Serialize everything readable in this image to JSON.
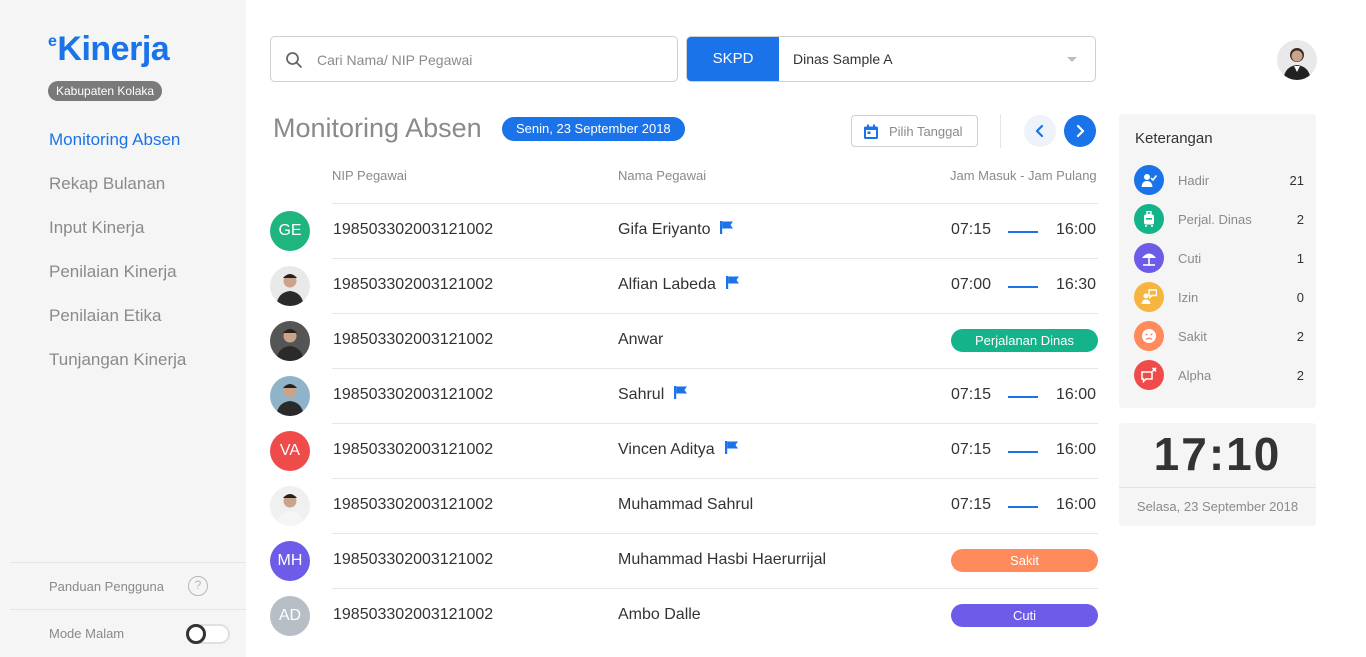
{
  "brand": {
    "logo_text": "Kinerja",
    "logo_prefix": "e",
    "region": "Kabupaten Kolaka"
  },
  "sidebar": {
    "items": [
      {
        "label": "Monitoring Absen"
      },
      {
        "label": "Rekap Bulanan"
      },
      {
        "label": "Input Kinerja"
      },
      {
        "label": "Penilaian Kinerja"
      },
      {
        "label": "Penilaian Etika"
      },
      {
        "label": "Tunjangan Kinerja"
      }
    ],
    "active_index": 0,
    "help_label": "Panduan Pengguna",
    "night_mode_label": "Mode Malam",
    "night_mode_on": false
  },
  "search": {
    "placeholder": "Cari Nama/ NIP Pegawai",
    "value": ""
  },
  "skpd": {
    "tag": "SKPD",
    "selected": "Dinas Sample A"
  },
  "header": {
    "title": "Monitoring Absen",
    "date": "Senin, 23 September 2018",
    "pick_date_label": "Pilih Tanggal"
  },
  "table": {
    "columns": {
      "nip": "NIP Pegawai",
      "name": "Nama Pegawai",
      "hours": "Jam Masuk - Jam Pulang"
    },
    "rows": [
      {
        "initials": "GE",
        "avatar_color": "#1fb57f",
        "nip": "198503302003121002",
        "name": "Gifa Eriyanto",
        "flag": true,
        "in": "07:15",
        "out": "16:00",
        "status": ""
      },
      {
        "initials": "",
        "avatar_color": "#3a3a3a",
        "nip": "198503302003121002",
        "name": "Alfian Labeda",
        "flag": true,
        "in": "07:00",
        "out": "16:30",
        "status": ""
      },
      {
        "initials": "",
        "avatar_color": "#4a4a4a",
        "nip": "198503302003121002",
        "name": "Anwar",
        "flag": false,
        "in": "",
        "out": "",
        "status": "Perjalanan Dinas",
        "status_color": "#14b389"
      },
      {
        "initials": "",
        "avatar_color": "#6b8fa8",
        "nip": "198503302003121002",
        "name": "Sahrul",
        "flag": true,
        "in": "07:15",
        "out": "16:00",
        "status": ""
      },
      {
        "initials": "VA",
        "avatar_color": "#ef4b4b",
        "nip": "198503302003121002",
        "name": "Vincen Aditya",
        "flag": true,
        "in": "07:15",
        "out": "16:00",
        "status": ""
      },
      {
        "initials": "",
        "avatar_color": "#9a9a9a",
        "nip": "198503302003121002",
        "name": "Muhammad Sahrul",
        "flag": false,
        "in": "07:15",
        "out": "16:00",
        "status": ""
      },
      {
        "initials": "MH",
        "avatar_color": "#6c5ce7",
        "nip": "198503302003121002",
        "name": "Muhammad Hasbi Haerurrijal",
        "flag": false,
        "in": "",
        "out": "",
        "status": "Sakit",
        "status_color": "#ff8a5c"
      },
      {
        "initials": "AD",
        "avatar_color": "#b7bec6",
        "nip": "198503302003121002",
        "name": "Ambo Dalle",
        "flag": false,
        "in": "",
        "out": "",
        "status": "Cuti",
        "status_color": "#6c5ce7"
      }
    ]
  },
  "legend": {
    "title": "Keterangan",
    "items": [
      {
        "label": "Hadir",
        "count": "21",
        "color": "#1a73e8",
        "icon": "user-check-icon"
      },
      {
        "label": "Perjal. Dinas",
        "count": "2",
        "color": "#14b389",
        "icon": "luggage-icon"
      },
      {
        "label": "Cuti",
        "count": "1",
        "color": "#6c5ce7",
        "icon": "beach-umbrella-icon"
      },
      {
        "label": "Izin",
        "count": "0",
        "color": "#f5b53f",
        "icon": "user-chat-icon"
      },
      {
        "label": "Sakit",
        "count": "2",
        "color": "#ff8a5c",
        "icon": "sick-face-icon"
      },
      {
        "label": "Alpha",
        "count": "2",
        "color": "#ef4b4b",
        "icon": "message-x-icon"
      }
    ]
  },
  "clock": {
    "time": "17:10",
    "date": "Selasa, 23 September 2018"
  },
  "colors": {
    "primary": "#1a73e8",
    "sidebar_bg": "#f5f5f5",
    "muted_text": "#8a8a8a"
  }
}
